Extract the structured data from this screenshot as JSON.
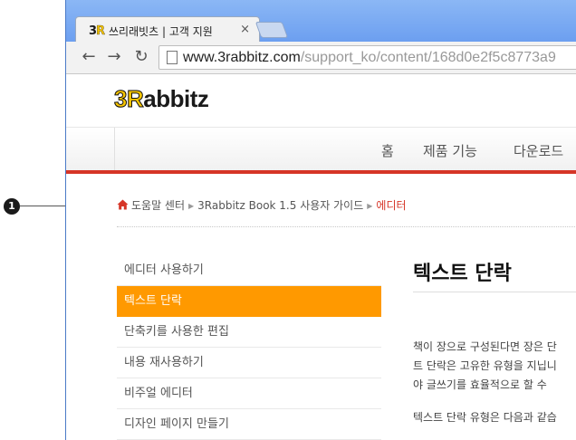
{
  "annotation": {
    "number": "1"
  },
  "browser": {
    "tab_title": "쓰리래빗츠 | 고객 지원",
    "tab_close": "×",
    "url_domain": "www.3rabbitz.com",
    "url_path": "/support_ko/content/168d0e2f5c8773a9",
    "back": "←",
    "forward": "→",
    "reload": "↻"
  },
  "site": {
    "logo_digit": "3R",
    "logo_rest": "abbitz",
    "nav": [
      "홈",
      "제품 기능",
      "다운로드"
    ]
  },
  "breadcrumb": {
    "items": [
      "도움말 센터",
      "3Rabbitz Book 1.5 사용자 가이드"
    ],
    "current": "에디터"
  },
  "sidebar": {
    "items": [
      {
        "label": "에디터 사용하기",
        "active": false
      },
      {
        "label": "텍스트 단락",
        "active": true
      },
      {
        "label": "단축키를 사용한 편집",
        "active": false
      },
      {
        "label": "내용 재사용하기",
        "active": false
      },
      {
        "label": "비주얼 에디터",
        "active": false
      },
      {
        "label": "디자인 페이지 만들기",
        "active": false
      }
    ]
  },
  "content": {
    "title": "텍스트 단락",
    "lines": [
      "책이 장으로 구성된다면 장은 단",
      "트 단락은 고유한 유형을 지닙니",
      "야 글쓰기를 효율적으로 할 수",
      "텍스트 단락 유형은 다음과 같습"
    ]
  },
  "colors": {
    "accent": "#ff9900",
    "red": "#d63527",
    "chrome_blue": "#6da3f0"
  }
}
